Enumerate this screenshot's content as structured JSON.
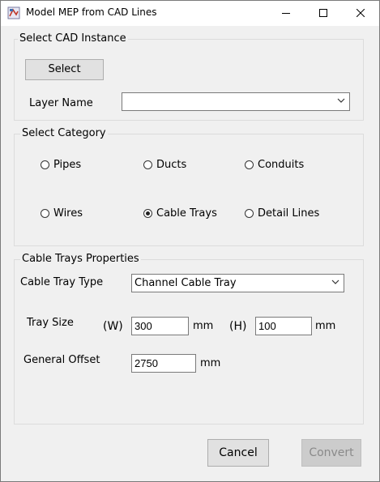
{
  "window": {
    "title": "Model MEP from CAD Lines",
    "icon": "app-icon",
    "controls": {
      "minimize": "minimize-icon",
      "maximize": "maximize-icon",
      "close": "close-icon"
    }
  },
  "cad": {
    "group_title": "Select CAD Instance",
    "select_label": "Select",
    "layer_label": "Layer Name",
    "layer_value": ""
  },
  "category": {
    "group_title": "Select Category",
    "options": [
      {
        "label": "Pipes",
        "selected": false
      },
      {
        "label": "Ducts",
        "selected": false
      },
      {
        "label": "Conduits",
        "selected": false
      },
      {
        "label": "Wires",
        "selected": false
      },
      {
        "label": "Cable Trays",
        "selected": true
      },
      {
        "label": "Detail Lines",
        "selected": false
      }
    ]
  },
  "properties": {
    "group_title": "Cable Trays Properties",
    "type_label": "Cable Tray Type",
    "type_value": "Channel Cable Tray",
    "size_label": "Tray Size",
    "width_label": "(W)",
    "width_value": "300",
    "width_unit": "mm",
    "height_label": "(H)",
    "height_value": "100",
    "height_unit": "mm",
    "offset_label": "General Offset",
    "offset_value": "2750",
    "offset_unit": "mm"
  },
  "actions": {
    "cancel_label": "Cancel",
    "convert_label": "Convert",
    "convert_enabled": false
  }
}
